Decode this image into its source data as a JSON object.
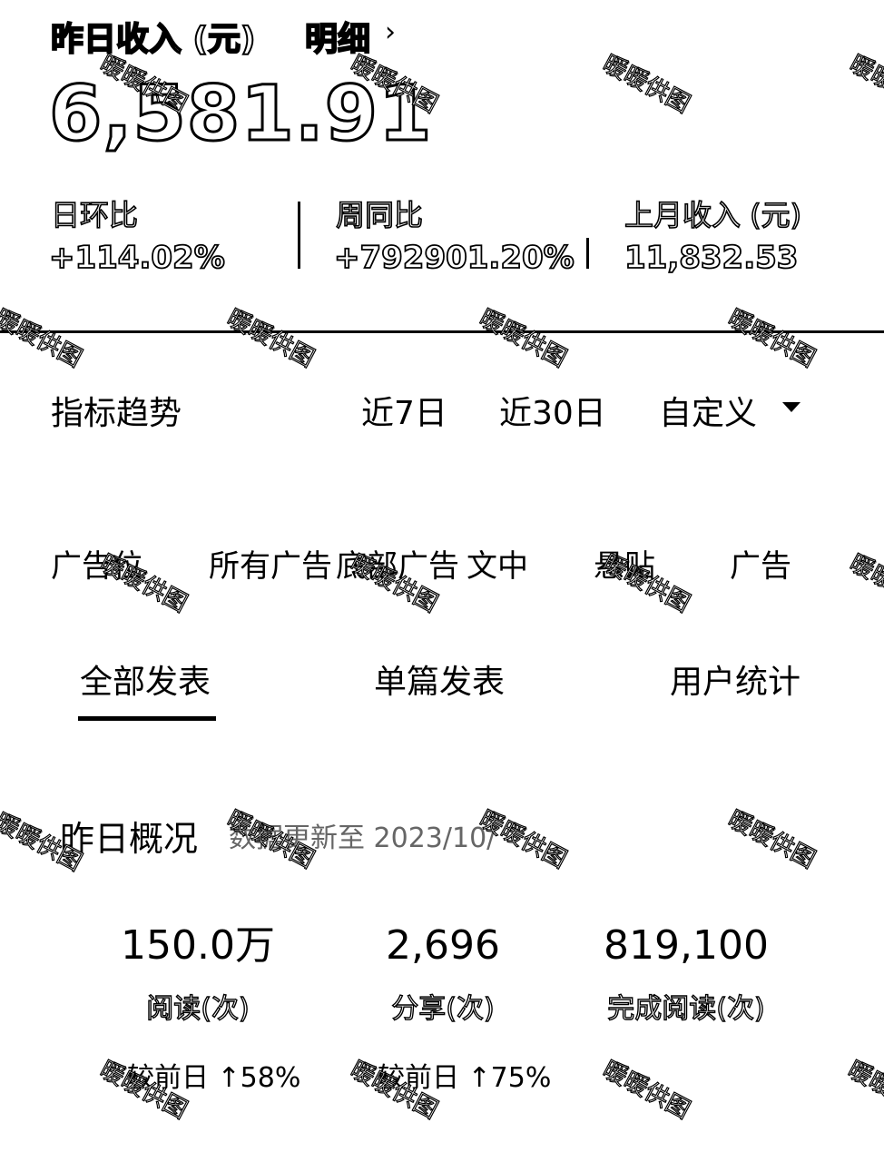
{
  "income": {
    "title": "昨日收入 (元)",
    "detail_link": "明细",
    "chevron": "›",
    "value": "6,581.91",
    "stats": [
      {
        "label": "日环比",
        "value": "+114.02%"
      },
      {
        "label": "周同比",
        "value": "+792901.20%"
      },
      {
        "label": "上月收入 (元)",
        "value": "11,832.53"
      }
    ]
  },
  "trend": {
    "title": "指标趋势",
    "ranges": [
      "近7日",
      "近30日",
      "自定义"
    ]
  },
  "ad_slots": [
    "广告位",
    "所有广告",
    "底部广告",
    "文中",
    "悬贴",
    "广告"
  ],
  "publish_tabs": [
    "全部发表",
    "单篇发表",
    "用户统计"
  ],
  "overview": {
    "title": "昨日概况",
    "update_note": "数据更新至 2023/10/",
    "metrics": [
      {
        "value": "150.0万",
        "label": "阅读(次)",
        "compare": "较前日 ↑58%"
      },
      {
        "value": "2,696",
        "label": "分享(次)",
        "compare": "较前日 ↑75%"
      },
      {
        "value": "819,100",
        "label": "完成阅读(次)",
        "compare": ""
      }
    ]
  },
  "watermark": "暖暖供图"
}
